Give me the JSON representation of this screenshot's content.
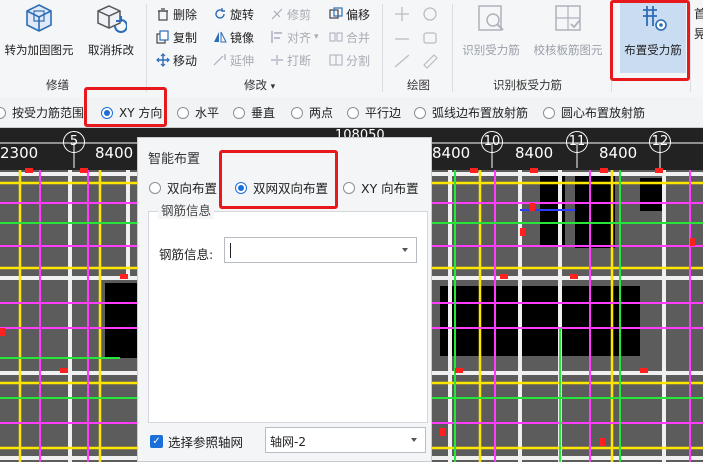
{
  "ribbon": {
    "groups": {
      "repair": "修缮",
      "modify": "修改",
      "modify_arrow": "▾",
      "draw": "绘图",
      "identify_slab": "识别板受力筋"
    },
    "buttons": {
      "convert_reinforced": "转为加固图元",
      "cancel_split": "取消拆改",
      "delete": "删除",
      "rotate": "旋转",
      "trim": "修剪",
      "offset": "偏移",
      "copy": "复制",
      "mirror": "镜像",
      "align": "对齐",
      "merge": "合并",
      "move": "移动",
      "extend": "延伸",
      "break": "打断",
      "split": "分割",
      "identify_rebar": "识别受力筋",
      "verify_slab_rebar": "校核板筋图元",
      "place_rebar": "布置受力筋",
      "cut_partial_1": "首",
      "cut_partial_2": "晃"
    }
  },
  "options": {
    "by_range": "按受力筋范围",
    "xy": "XY 方向",
    "horizontal": "水平",
    "vertical": "垂直",
    "two_points": "两点",
    "parallel_edge": "平行边",
    "arc_radial": "弧线边布置放射筋",
    "center_radial": "圆心布置放射筋"
  },
  "axis": {
    "top_dim": "108050",
    "labels": [
      "2300",
      "8400",
      "8400",
      "8400",
      "8400"
    ],
    "nums": [
      "5",
      "10",
      "11",
      "12"
    ]
  },
  "panel": {
    "title": "智能布置",
    "opt_bidirectional": "双向布置",
    "opt_double_net": "双网双向布置",
    "opt_xy": "XY 向布置",
    "section_title": "钢筋信息",
    "rebar_label": "钢筋信息:",
    "rebar_value": "",
    "ref_axis_label": "选择参照轴网",
    "axis_value": "轴网-2"
  },
  "colors": {
    "highlight": "#e8191d",
    "accent": "#1c6fd6",
    "canvas_bg": "#222222"
  }
}
